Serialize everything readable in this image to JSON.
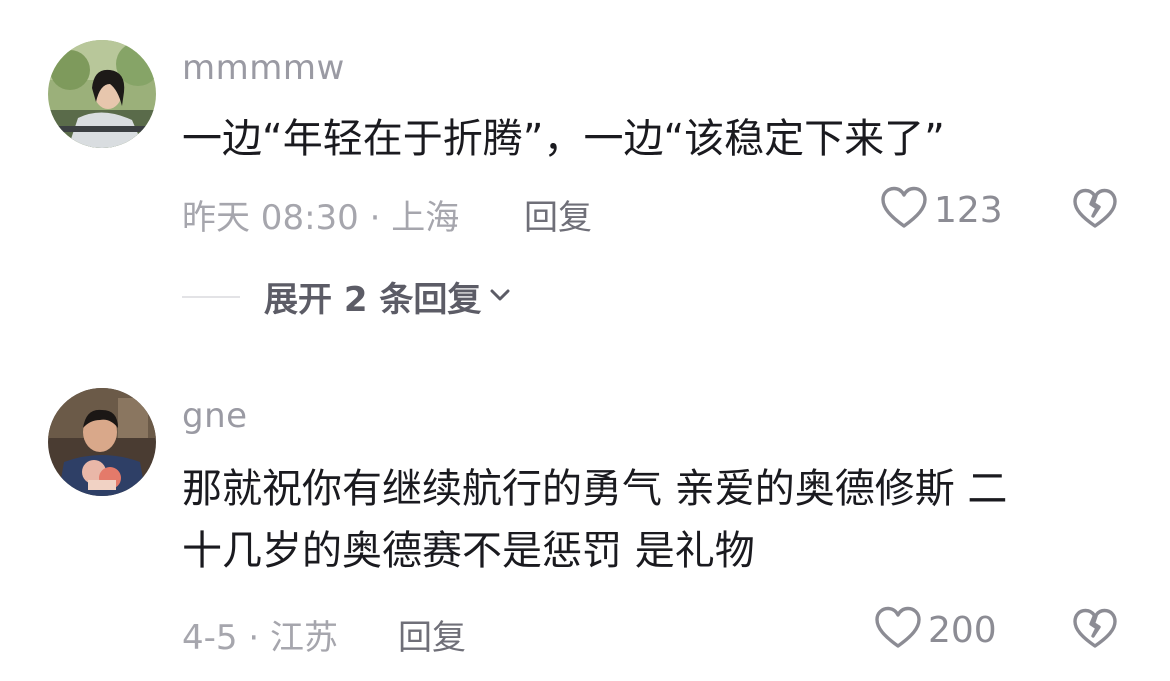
{
  "comments": [
    {
      "username": "mmmmw",
      "lines": [
        "一边“年轻在于折腾”，一边“该稳定下来了”"
      ],
      "time_location": "昨天 08:30 · 上海",
      "reply_label": "回复",
      "like_count": "123",
      "expand_label": "展开 2 条回复"
    },
    {
      "username": "gne",
      "lines": [
        "那就祝你有继续航行的勇气 亲爱的奥德修斯 二",
        "十几岁的奥德赛不是惩罚 是礼物"
      ],
      "time_location": "4-5 · 江苏",
      "reply_label": "回复",
      "like_count": "200"
    }
  ],
  "icons": {
    "like": "heart-outline-icon",
    "dislike": "broken-heart-icon",
    "expand": "chevron-down-icon"
  },
  "colors": {
    "username": "#9a9aa3",
    "text": "#1a1a1f",
    "meta": "#a6a6ad",
    "icon": "#8c8c94"
  }
}
